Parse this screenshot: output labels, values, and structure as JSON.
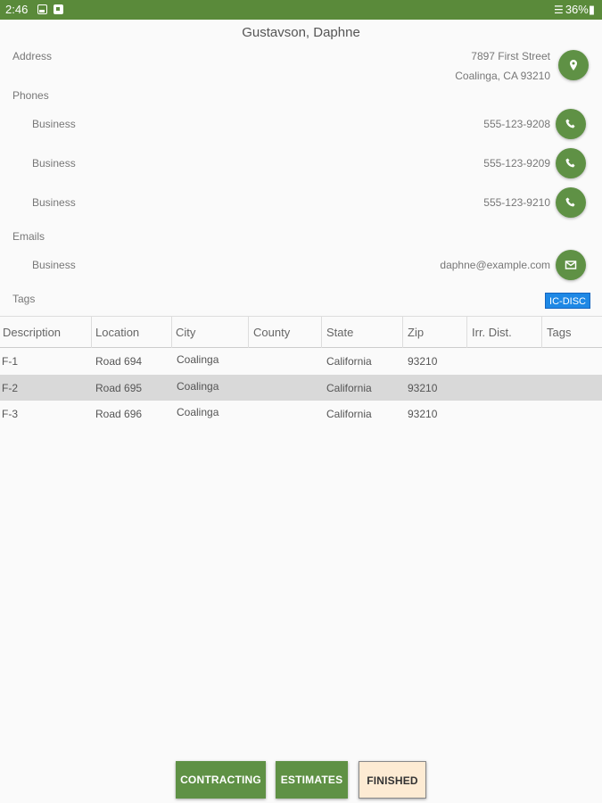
{
  "status_bar": {
    "time": "2:46",
    "battery": "36%",
    "icons": [
      "image-icon",
      "app-icon",
      "wifi-icon",
      "battery-icon"
    ]
  },
  "contact": {
    "name": "Gustavson, Daphne",
    "address_label": "Address",
    "address_line1": "7897 First Street",
    "address_line2": "Coalinga, CA 93210",
    "phones_label": "Phones",
    "phones": [
      {
        "type": "Business",
        "number": "555-123-9208"
      },
      {
        "type": "Business",
        "number": "555-123-9209"
      },
      {
        "type": "Business",
        "number": "555-123-9210"
      }
    ],
    "emails_label": "Emails",
    "emails": [
      {
        "type": "Business",
        "address": "daphne@example.com"
      }
    ],
    "tags_label": "Tags",
    "tags": [
      "IC-DISC"
    ]
  },
  "table": {
    "columns": [
      "Description",
      "Location",
      "City",
      "County",
      "State",
      "Zip",
      "Irr. Dist.",
      "Tags"
    ],
    "rows": [
      {
        "description": "F-1",
        "location": "Road 694",
        "city": "Coalinga",
        "county": "",
        "state": "California",
        "zip": "93210",
        "irr_dist": "",
        "tags": "",
        "selected": false
      },
      {
        "description": "F-2",
        "location": "Road 695",
        "city": "Coalinga",
        "county": "",
        "state": "California",
        "zip": "93210",
        "irr_dist": "",
        "tags": "",
        "selected": true
      },
      {
        "description": "F-3",
        "location": "Road 696",
        "city": "Coalinga",
        "county": "",
        "state": "California",
        "zip": "93210",
        "irr_dist": "",
        "tags": "",
        "selected": false
      }
    ]
  },
  "actions": {
    "contracting": "CONTRACTING",
    "estimates": "ESTIMATES",
    "finished": "FINISHED"
  },
  "colors": {
    "accent_green": "#5f9145",
    "status_bar": "#5a8a3a",
    "tag_blue": "#1e88e5",
    "selected_row": "#d9d9d9",
    "finished_bg": "#fdebd3"
  }
}
